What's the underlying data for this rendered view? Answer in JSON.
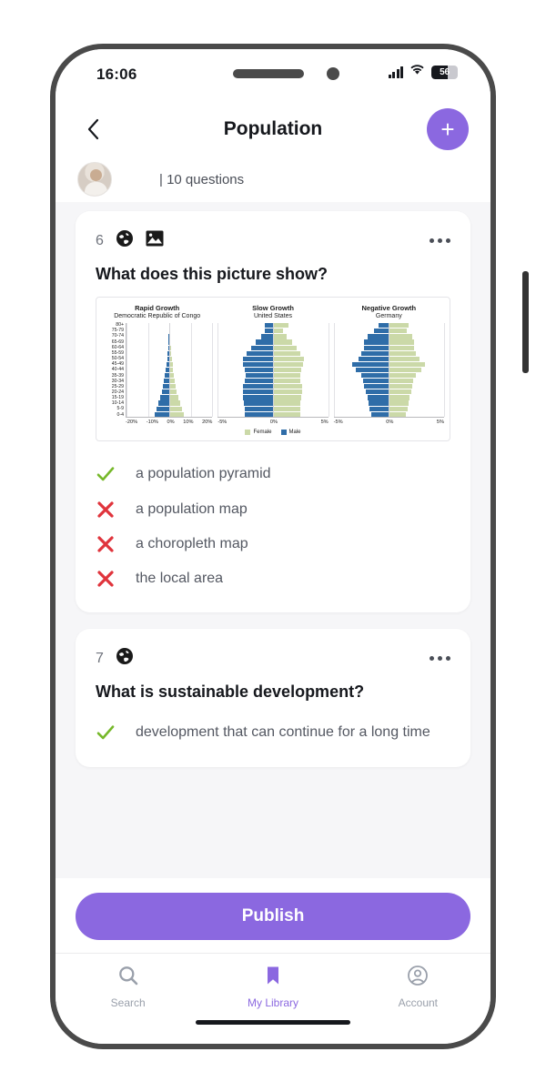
{
  "status_bar": {
    "time": "16:06",
    "signal_icon": "cellular-signal-icon",
    "wifi_icon": "wifi-icon",
    "battery_percent": "56",
    "battery_icon": "battery-icon"
  },
  "nav": {
    "back_icon": "chevron-left-icon",
    "title": "Population",
    "add_label": "+",
    "add_icon": "plus-icon"
  },
  "meta": {
    "avatar_icon": "user-avatar",
    "text": "| 10 questions"
  },
  "questions": [
    {
      "number": "6",
      "subject_icon": "globe-icon",
      "media_icon": "image-icon",
      "menu_icon": "more-options-icon",
      "text": "What does this picture show?",
      "options": [
        {
          "mark": "check-icon",
          "correct": true,
          "label": "a population pyramid"
        },
        {
          "mark": "cross-icon",
          "correct": false,
          "label": "a population map"
        },
        {
          "mark": "cross-icon",
          "correct": false,
          "label": "a choropleth map"
        },
        {
          "mark": "cross-icon",
          "correct": false,
          "label": "the local area"
        }
      ]
    },
    {
      "number": "7",
      "subject_icon": "globe-icon",
      "menu_icon": "more-options-icon",
      "text": "What is sustainable development?",
      "options": [
        {
          "mark": "check-icon",
          "correct": true,
          "label": "development that can continue for a long time"
        }
      ]
    }
  ],
  "publish": {
    "label": "Publish"
  },
  "tabs": [
    {
      "label": "Search",
      "icon": "search-icon",
      "active": false
    },
    {
      "label": "My Library",
      "icon": "bookmark-icon",
      "active": true
    },
    {
      "label": "Account",
      "icon": "account-icon",
      "active": false
    }
  ],
  "colors": {
    "accent": "#8b68e0",
    "correct": "#76b82a",
    "incorrect": "#e0343c",
    "male": "#2f6da8",
    "female": "#cbd9a8",
    "screen_bg": "#f6f6f8"
  },
  "chart_data": [
    {
      "type": "bar",
      "title": "Rapid Growth",
      "subtitle": "Democratic Republic of Congo",
      "xlabel": "",
      "ylabel": "",
      "xticks": [
        "-20%",
        "-10%",
        "0%",
        "10%",
        "20%"
      ],
      "xlim": [
        -25,
        25
      ],
      "grid": true,
      "legend": [
        "Female",
        "Male"
      ],
      "legend_position": "bottom-center",
      "categories": [
        "0-4",
        "5-9",
        "10-14",
        "15-19",
        "20-24",
        "25-29",
        "30-34",
        "35-39",
        "40-44",
        "45-49",
        "50-54",
        "55-59",
        "60-64",
        "65-69",
        "70-74",
        "75-79",
        "80+"
      ],
      "series": [
        {
          "name": "Male",
          "values": [
            8.6,
            7.3,
            6.2,
            5.3,
            4.5,
            3.8,
            3.2,
            2.7,
            2.2,
            1.8,
            1.4,
            1.1,
            0.8,
            0.6,
            0.4,
            0.25,
            0.15
          ]
        },
        {
          "name": "Female",
          "values": [
            8.4,
            7.1,
            6.1,
            5.2,
            4.4,
            3.7,
            3.1,
            2.6,
            2.2,
            1.8,
            1.5,
            1.2,
            0.9,
            0.7,
            0.5,
            0.3,
            0.2
          ]
        }
      ]
    },
    {
      "type": "bar",
      "title": "Slow Growth",
      "subtitle": "United States",
      "xlabel": "",
      "ylabel": "",
      "xticks": [
        "-5%",
        "0%",
        "5%"
      ],
      "xlim": [
        -6.5,
        6.5
      ],
      "grid": true,
      "legend": [
        "Female",
        "Male"
      ],
      "legend_position": "bottom-center",
      "categories": [
        "0-4",
        "5-9",
        "10-14",
        "15-19",
        "20-24",
        "25-29",
        "30-34",
        "35-39",
        "40-44",
        "45-49",
        "50-54",
        "55-59",
        "60-64",
        "65-69",
        "70-74",
        "75-79",
        "80+"
      ],
      "series": [
        {
          "name": "Male",
          "values": [
            3.3,
            3.3,
            3.4,
            3.5,
            3.5,
            3.5,
            3.3,
            3.2,
            3.3,
            3.5,
            3.5,
            3.1,
            2.6,
            2.0,
            1.4,
            1.0,
            1.0
          ]
        },
        {
          "name": "Female",
          "values": [
            3.2,
            3.2,
            3.2,
            3.3,
            3.4,
            3.4,
            3.2,
            3.2,
            3.3,
            3.5,
            3.6,
            3.2,
            2.8,
            2.2,
            1.6,
            1.2,
            1.8
          ]
        }
      ]
    },
    {
      "type": "bar",
      "title": "Negative Growth",
      "subtitle": "Germany",
      "xlabel": "",
      "ylabel": "",
      "xticks": [
        "-5%",
        "0%",
        "5%"
      ],
      "xlim": [
        -6.5,
        6.5
      ],
      "grid": true,
      "legend": [
        "Female",
        "Male"
      ],
      "legend_position": "bottom-center",
      "categories": [
        "0-4",
        "5-9",
        "10-14",
        "15-19",
        "20-24",
        "25-29",
        "30-34",
        "35-39",
        "40-44",
        "45-49",
        "50-54",
        "55-59",
        "60-64",
        "65-69",
        "70-74",
        "75-79",
        "80+"
      ],
      "series": [
        {
          "name": "Male",
          "values": [
            2.1,
            2.3,
            2.4,
            2.5,
            2.7,
            2.9,
            3.0,
            3.3,
            3.9,
            4.3,
            3.6,
            3.2,
            2.9,
            2.9,
            2.5,
            1.7,
            1.2
          ]
        },
        {
          "name": "Female",
          "values": [
            2.0,
            2.2,
            2.3,
            2.4,
            2.6,
            2.8,
            2.9,
            3.2,
            3.8,
            4.2,
            3.6,
            3.2,
            3.0,
            3.0,
            2.7,
            2.1,
            2.3
          ]
        }
      ]
    }
  ]
}
